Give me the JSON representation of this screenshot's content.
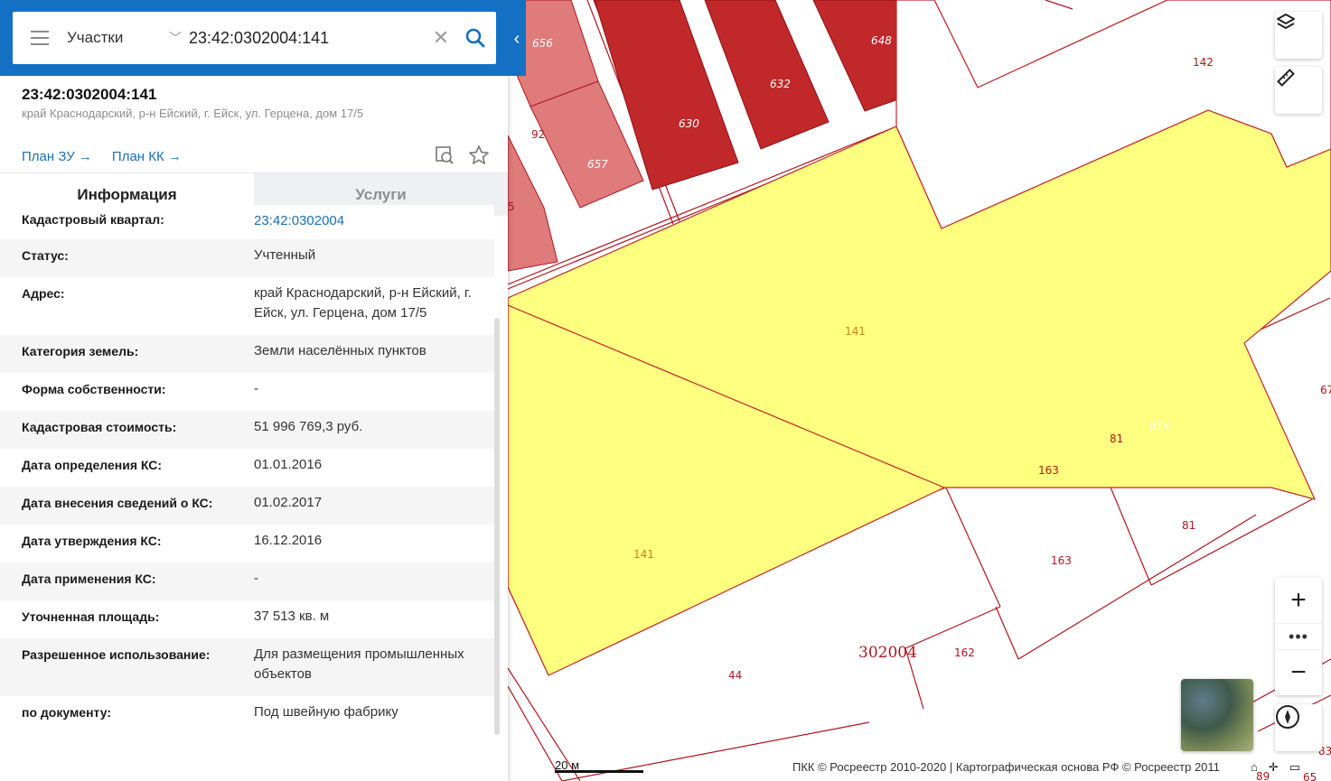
{
  "search": {
    "layer_label": "Участки",
    "query": "23:42:0302004:141"
  },
  "object": {
    "title": "23:42:0302004:141",
    "address": "край Краснодарский, р-н Ейский, г. Ейск, ул. Герцена, дом 17/5",
    "links": [
      "План ЗУ",
      "План КК"
    ]
  },
  "tabs": [
    "Информация",
    "Услуги"
  ],
  "info": [
    {
      "key": "Кадастровый квартал:",
      "value": "23:42:0302004"
    },
    {
      "key": "Статус:",
      "value": "Учтенный"
    },
    {
      "key": "Адрес:",
      "value": "край Краснодарский, р-н Ейский, г. Ейск, ул. Герцена, дом 17/5"
    },
    {
      "key": "Категория земель:",
      "value": "Земли населённых пунктов"
    },
    {
      "key": "Форма собственности:",
      "value": "-"
    },
    {
      "key": "Кадастровая стоимость:",
      "value": "51 996 769,3 руб."
    },
    {
      "key": "Дата определения КС:",
      "value": "01.01.2016"
    },
    {
      "key": "Дата внесения сведений о КС:",
      "value": "01.02.2017"
    },
    {
      "key": "Дата утверждения КС:",
      "value": "16.12.2016"
    },
    {
      "key": "Дата применения КС:",
      "value": "-"
    },
    {
      "key": "Уточненная площадь:",
      "value": "37 513 кв. м"
    },
    {
      "key": "Разрешенное использование:",
      "value": "Для размещения промышленных объектов"
    },
    {
      "key": "по документу:",
      "value": "Под швейную фабрику"
    }
  ],
  "map": {
    "plot_labels": [
      "656",
      "92",
      "657",
      "630",
      "632",
      "648",
      "142",
      "141",
      "141",
      "614",
      "81",
      "163",
      "81",
      "163",
      "162",
      "44",
      "67",
      "83",
      "89",
      "65",
      "5"
    ],
    "quarter_label": "302004",
    "scale_label": "20 м",
    "copyright": "ПКК © Росреестр 2010-2020 | Картографическая основа РФ © Росреестр 2011"
  },
  "colors": {
    "header_blue": "#1370c3",
    "link_blue": "#1a6fb5",
    "selected_plot": "#ffff80",
    "building_dark_red": "#c0282a",
    "building_pink": "#e07b7b",
    "boundary_red": "#b0151e"
  }
}
